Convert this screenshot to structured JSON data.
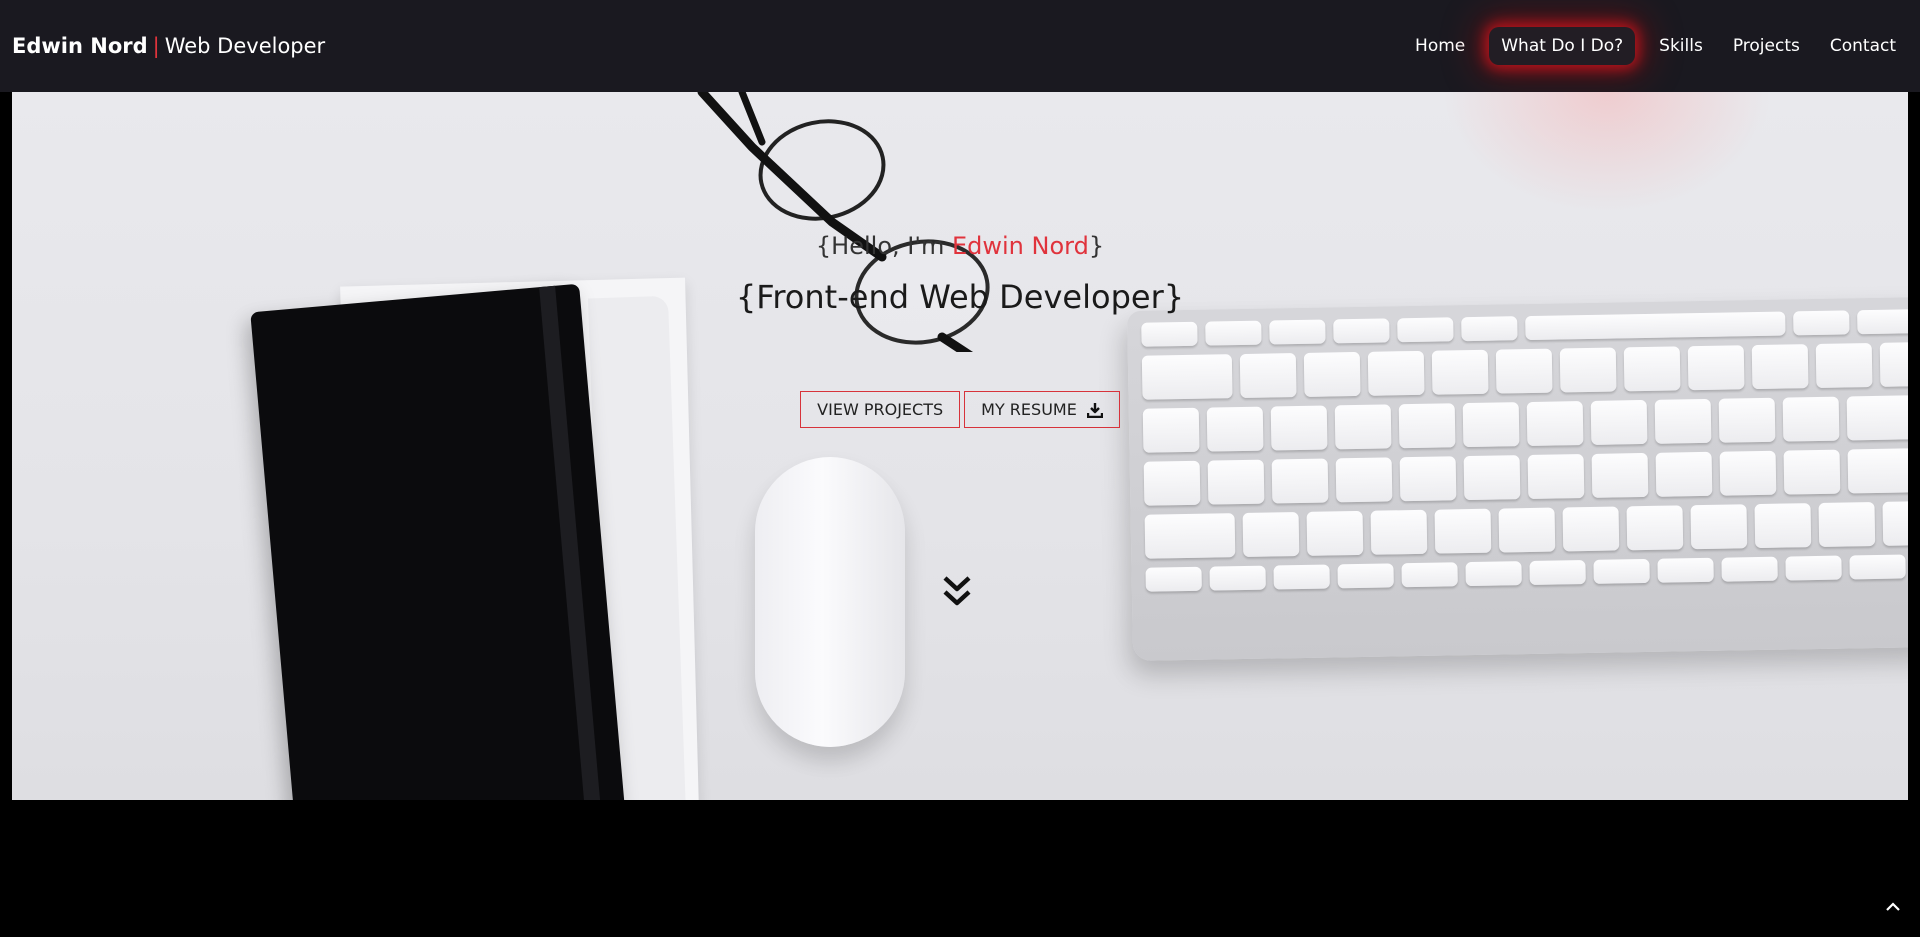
{
  "brand": {
    "name": "Edwin Nord",
    "separator": "|",
    "role": "Web Developer"
  },
  "nav": {
    "items": [
      {
        "label": "Home"
      },
      {
        "label": "What Do I Do?",
        "active": true
      },
      {
        "label": "Skills"
      },
      {
        "label": "Projects"
      },
      {
        "label": "Contact"
      }
    ]
  },
  "hero": {
    "greeting_prefix": "{Hello, I'm ",
    "greeting_name": "Edwin Nord",
    "greeting_suffix": "}",
    "headline": "{Front-end Web Developer}",
    "buttons": {
      "projects": "VIEW PROJECTS",
      "resume": "MY RESUME"
    }
  },
  "icons": {
    "resume": "download-icon",
    "scroll": "double-chevron-down-icon",
    "back_to_top": "chevron-up-icon"
  },
  "colors": {
    "accent": "#e0333c",
    "nav_bg": "#1a1920",
    "page_bg": "#000000"
  }
}
